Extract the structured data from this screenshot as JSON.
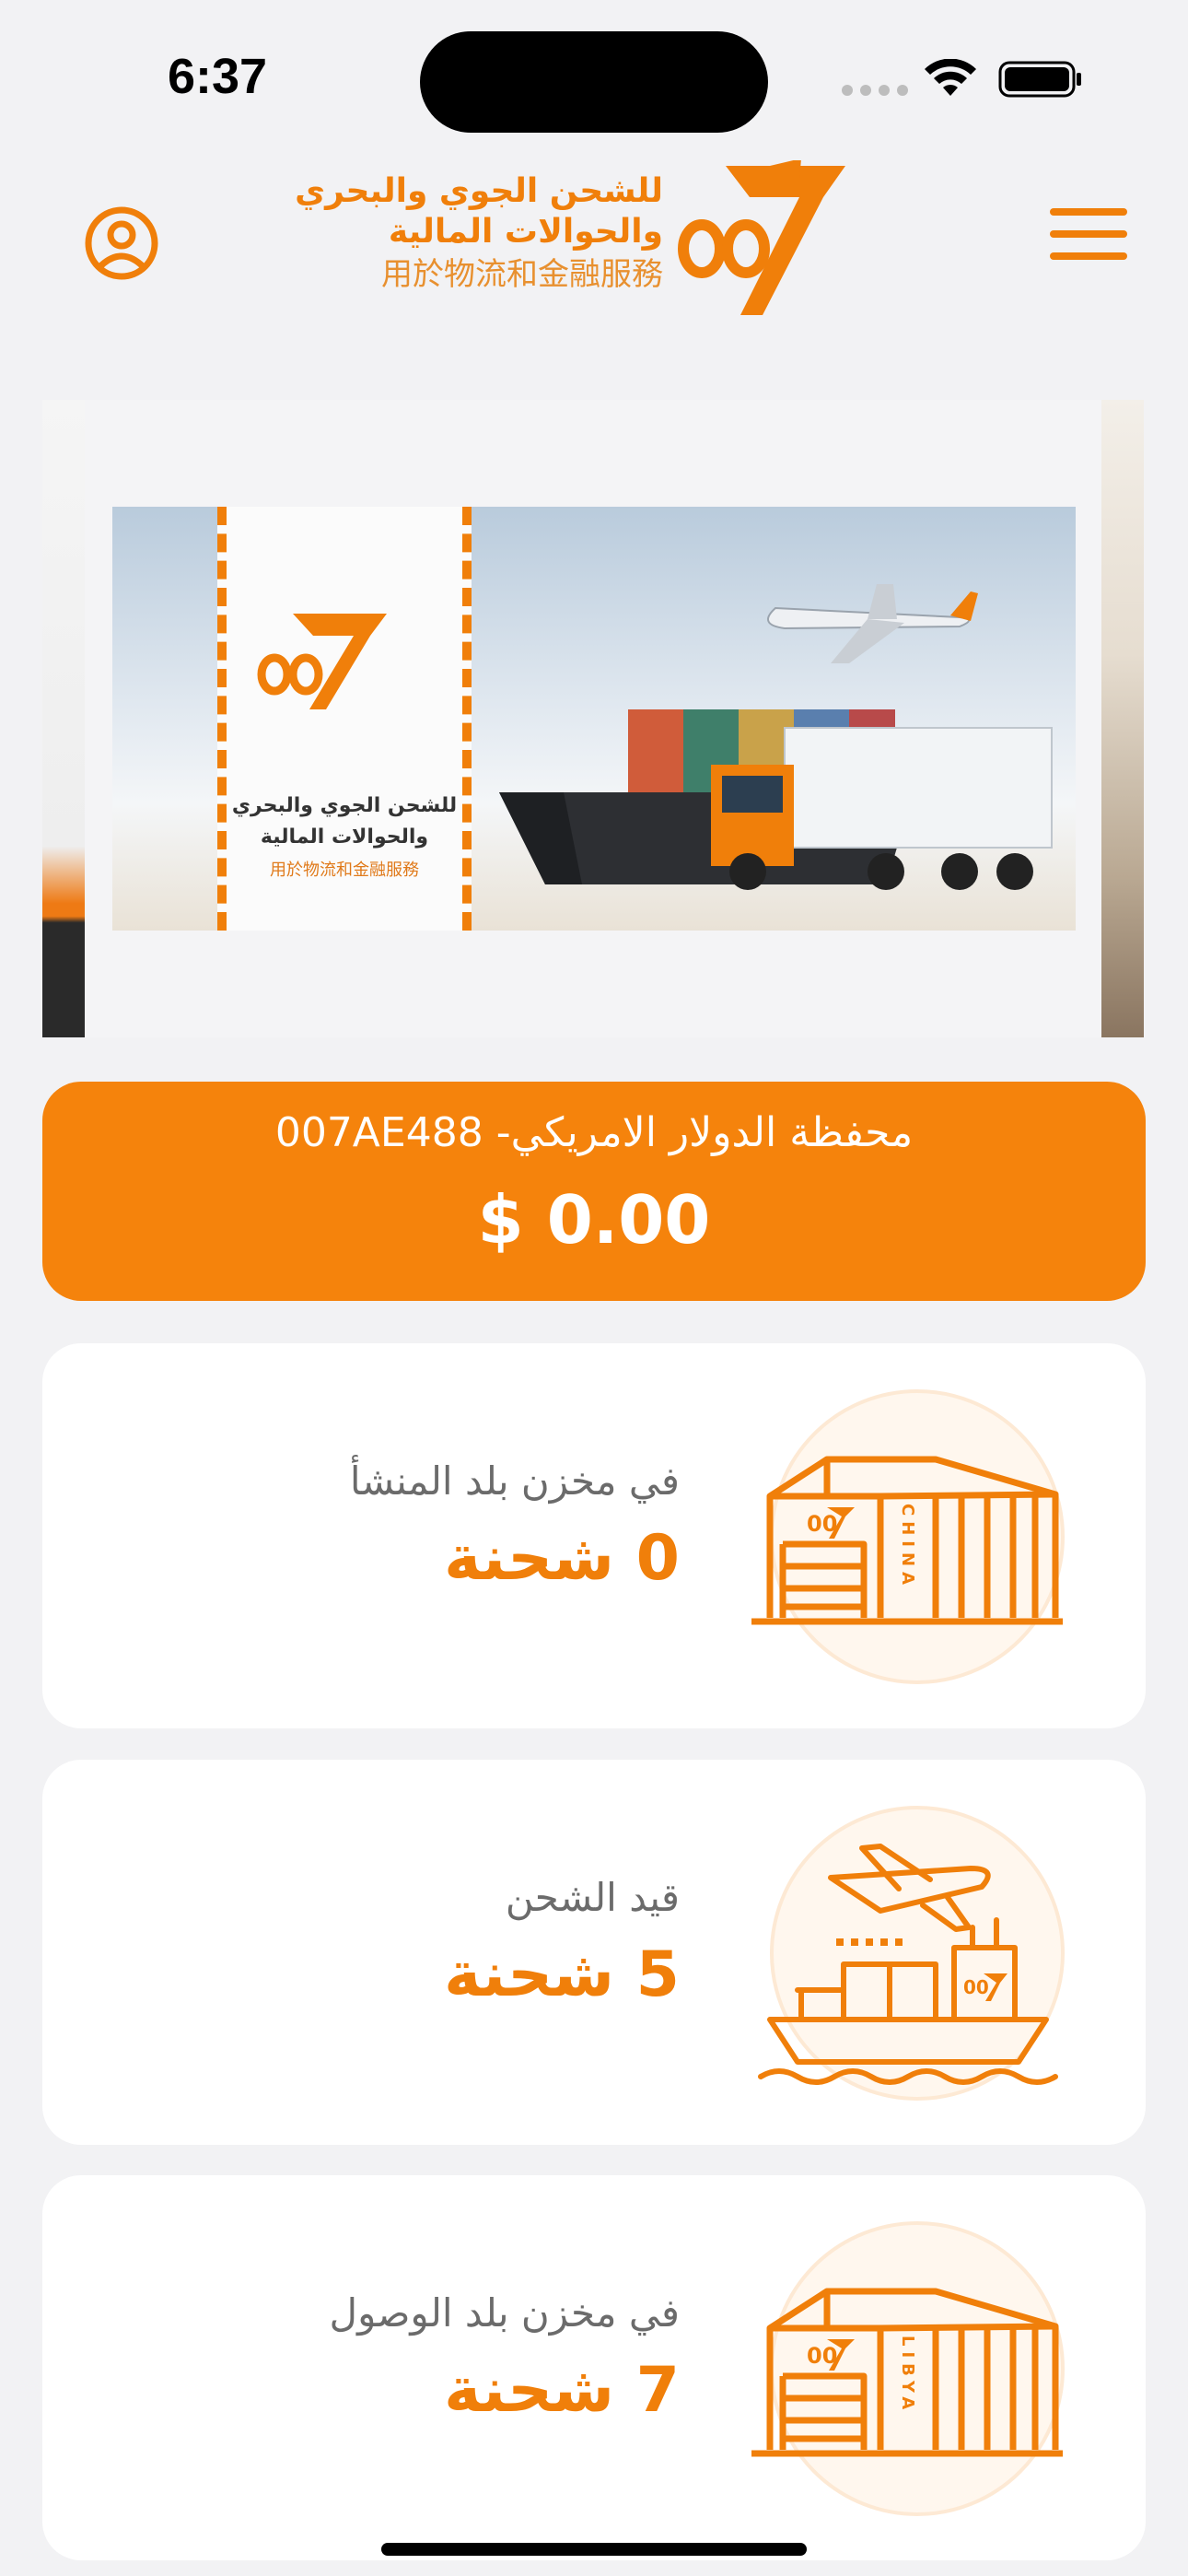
{
  "status_bar": {
    "time": "6:37"
  },
  "header": {
    "logo_line1": "للشحن الجوي والبحري",
    "logo_line2": "والحوالات المالية",
    "logo_line3": "用於物流和金融服務"
  },
  "banner": {
    "line1": "للشحن الجوي والبحري",
    "line2": "والحوالات المالية",
    "line3": "用於物流和金融服務"
  },
  "wallet": {
    "title": "محفظة الدولار الامريكي- 007AE488",
    "balance": "$ 0.00"
  },
  "cards": [
    {
      "label": "في مخزن بلد المنشأ",
      "count": "0 شحنة",
      "icon": "warehouse-china-icon",
      "tag": "CHINA"
    },
    {
      "label": "قيد الشحن",
      "count": "5 شحنة",
      "icon": "ship-plane-icon"
    },
    {
      "label": "في مخزن بلد الوصول",
      "count": "7 شحنة",
      "icon": "warehouse-libya-icon",
      "tag": "LIBYA"
    }
  ],
  "colors": {
    "accent": "#f07f0a",
    "wallet": "#f5830c",
    "background": "#f2f2f4"
  }
}
